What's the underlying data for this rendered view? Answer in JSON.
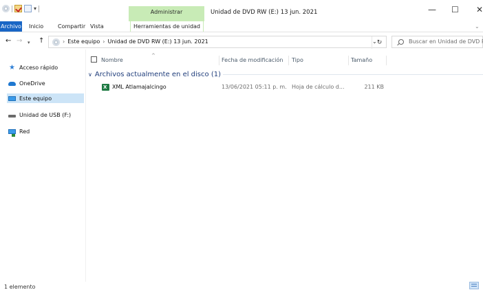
{
  "window": {
    "title": "Unidad de DVD RW (E:) 13 jun. 2021",
    "contextual_tab_group": "Administrar",
    "controls": {
      "minimize": "—",
      "maximize": "☐",
      "close": "✕"
    }
  },
  "quick_access_toolbar": {
    "dropdown": "▾"
  },
  "ribbon": {
    "tabs": [
      {
        "label": "Archivo"
      },
      {
        "label": "Inicio"
      },
      {
        "label": "Compartir"
      },
      {
        "label": "Vista"
      },
      {
        "label": "Herramientas de unidad"
      }
    ],
    "expand_chevron": "⌄"
  },
  "navigation": {
    "back": "←",
    "forward": "→",
    "recent": "▾",
    "up": "↑",
    "breadcrumb": [
      "Este equipo",
      "Unidad de DVD RW (E:) 13 jun. 2021"
    ],
    "separator": "›",
    "address_dropdown": "⌄",
    "refresh": "↻",
    "search_placeholder": "Buscar en Unidad de DVD R..."
  },
  "sidebar": {
    "items": [
      {
        "label": "Acceso rápido",
        "icon": "star-icon"
      },
      {
        "label": "OneDrive",
        "icon": "cloud-icon"
      },
      {
        "label": "Este equipo",
        "icon": "computer-icon",
        "selected": true
      },
      {
        "label": "Unidad de USB (F:)",
        "icon": "usb-drive-icon"
      },
      {
        "label": "Red",
        "icon": "network-icon"
      }
    ]
  },
  "file_list": {
    "columns": {
      "name": "Nombre",
      "modified": "Fecha de modificación",
      "type": "Tipo",
      "size": "Tamaño",
      "sort_indicator": "^"
    },
    "group_chevron": "∨",
    "group_label": "Archivos actualmente en el disco (1)",
    "rows": [
      {
        "name": "XML Atlamajalcingo",
        "modified": "13/06/2021 05:11 p. m.",
        "type": "Hoja de cálculo d...",
        "size": "211 KB",
        "icon": "excel-file-icon"
      }
    ]
  },
  "status_bar": {
    "count": "1 elemento"
  },
  "colors": {
    "accent": "#1966c5",
    "contextual": "#c8ebb6",
    "selection": "#cce4f7",
    "group_header": "#1e3c7a"
  }
}
